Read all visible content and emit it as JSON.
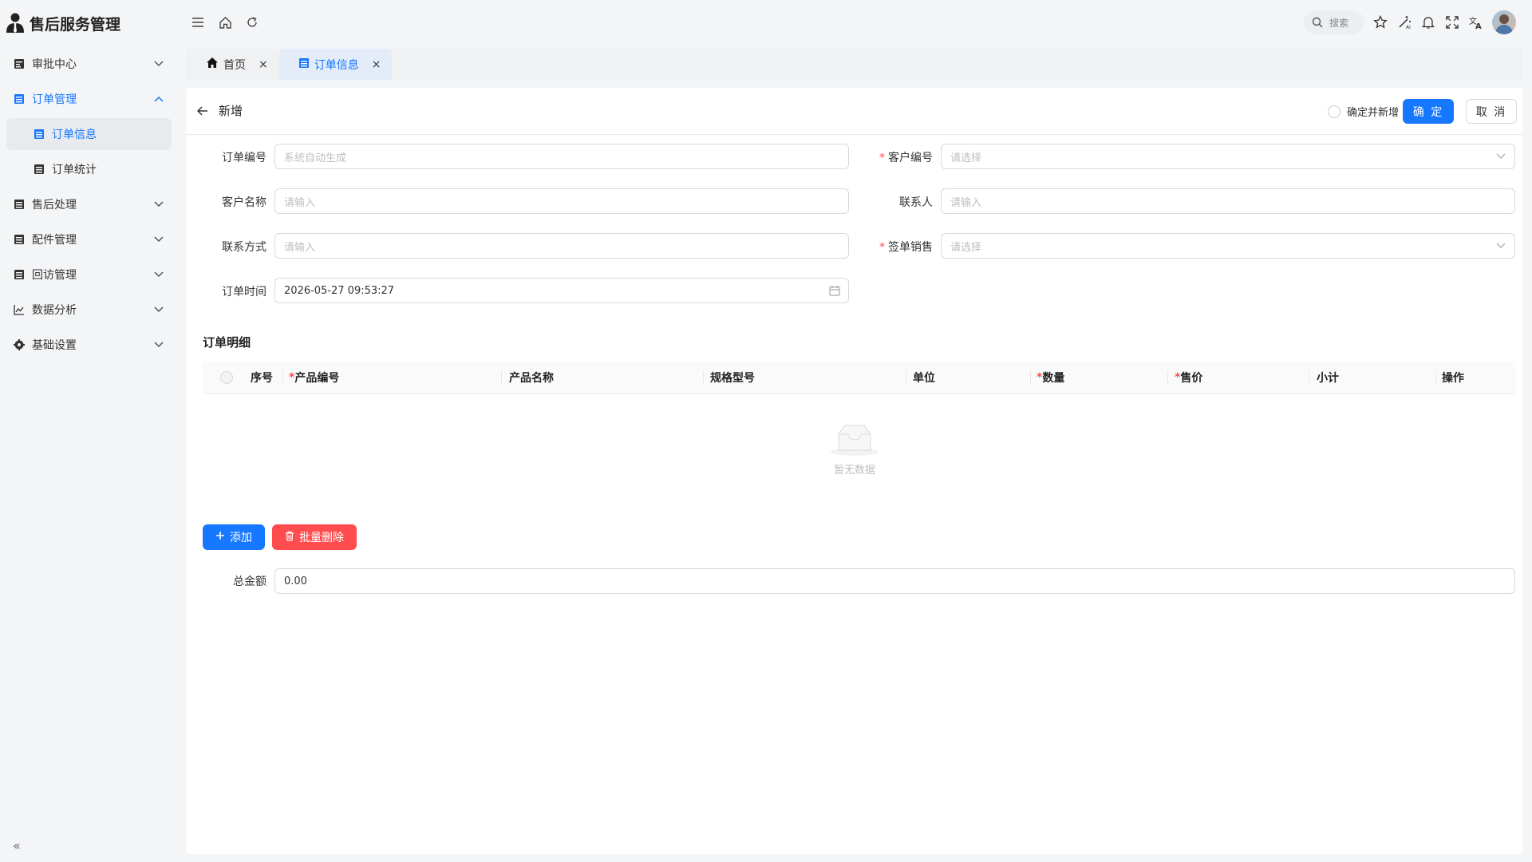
{
  "app": {
    "title": "售后服务管理"
  },
  "sidebar": {
    "items": [
      {
        "label": "审批中心"
      },
      {
        "label": "订单管理"
      },
      {
        "label": "订单信息"
      },
      {
        "label": "订单统计"
      },
      {
        "label": "售后处理"
      },
      {
        "label": "配件管理"
      },
      {
        "label": "回访管理"
      },
      {
        "label": "数据分析"
      },
      {
        "label": "基础设置"
      }
    ],
    "collapse_label": "«"
  },
  "header": {
    "search_placeholder": "搜索"
  },
  "tabs": [
    {
      "label": "首页",
      "close": "×"
    },
    {
      "label": "订单信息",
      "close": "×"
    }
  ],
  "form": {
    "title": "新增",
    "confirm_and_add": "确定并新增",
    "confirm": "确 定",
    "cancel": "取 消",
    "order_no": {
      "label": "订单编号",
      "placeholder": "系统自动生成"
    },
    "customer_no": {
      "label": "客户编号",
      "placeholder": "请选择"
    },
    "customer_name": {
      "label": "客户名称",
      "placeholder": "请输入"
    },
    "contact": {
      "label": "联系人",
      "placeholder": "请输入"
    },
    "contact_method": {
      "label": "联系方式",
      "placeholder": "请输入"
    },
    "sales": {
      "label": "签单销售",
      "placeholder": "请选择"
    },
    "order_time": {
      "label": "订单时间",
      "value": "2026-05-27 09:53:27"
    },
    "required_mark": "*"
  },
  "details": {
    "title": "订单明细",
    "columns": [
      {
        "label": "序号",
        "required": false
      },
      {
        "label": "产品编号",
        "required": true
      },
      {
        "label": "产品名称",
        "required": false
      },
      {
        "label": "规格型号",
        "required": false
      },
      {
        "label": "单位",
        "required": false
      },
      {
        "label": "数量",
        "required": true
      },
      {
        "label": "售价",
        "required": true
      },
      {
        "label": "小计",
        "required": false
      },
      {
        "label": "操作",
        "required": false
      }
    ],
    "empty_text": "暂无数据",
    "add_button": "添加",
    "batch_delete_button": "批量删除"
  },
  "total": {
    "label": "总金额",
    "value": "0.00"
  },
  "colors": {
    "primary": "#1677ff",
    "danger": "#ff4d4f"
  }
}
